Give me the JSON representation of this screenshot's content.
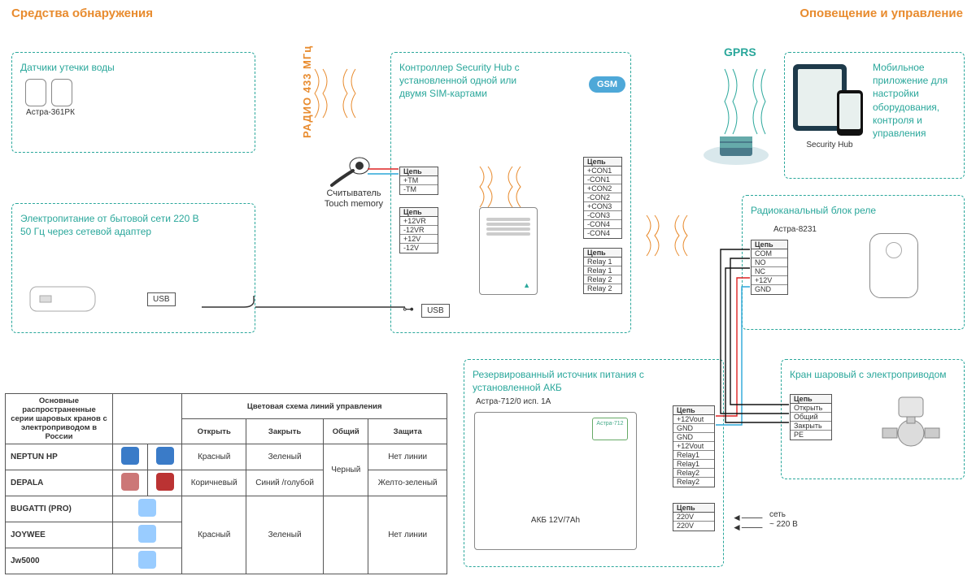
{
  "headings": {
    "left": "Средства обнаружения",
    "right": "Оповещение и управление"
  },
  "links": {
    "radio": "РАДИО 433 МГц",
    "gprs": "GPRS",
    "gsm": "GSM",
    "touch_memory": "Считыватель\nTouch memory"
  },
  "boxes": {
    "water": {
      "title": "Датчики утечки воды",
      "model": "Астра-361РК"
    },
    "power_usb": {
      "title": "Электропитание от бытовой сети 220 В 50 Гц через сетевой адаптер",
      "usb": "USB"
    },
    "controller": {
      "title": "Контроллер Security Hub с установленной одной или двумя SIM-картами",
      "usb": "USB"
    },
    "mobile": {
      "title": "Мобильное приложение для настройки оборудования, контроля и управления",
      "sub": "Security Hub"
    },
    "relay_radio": {
      "title": "Радиоканальный блок реле",
      "model": "Астра-8231"
    },
    "psu": {
      "title": "Резервированный источник питания с установленной АКБ",
      "model": "Астра-712/0 исп. 1А",
      "akb": "АКБ 12V/7Ah"
    },
    "valve": {
      "title": "Кран шаровый с электроприводом"
    },
    "mains": {
      "label1": "сеть",
      "label2": "~ 220 В"
    }
  },
  "terminals": {
    "head": "Цепь",
    "tm": [
      "+ТМ",
      "-ТМ"
    ],
    "pwr12": [
      "+12VR",
      "-12VR",
      "+12V",
      "-12V"
    ],
    "con": [
      "+CON1",
      "-CON1",
      "+CON2",
      "-CON2",
      "+CON3",
      "-CON3",
      "-CON4",
      "-CON4"
    ],
    "relay_hub": [
      "Relay 1",
      "Relay 1",
      "Relay 2",
      "Relay 2"
    ],
    "relay_astra": [
      "COM",
      "NO",
      "NC",
      "+12V",
      "GND"
    ],
    "psu_out": [
      "+12Vout",
      "GND",
      "GND",
      "+12Vout",
      "Relay1",
      "Relay1",
      "Relay2",
      "Relay2"
    ],
    "psu_220": [
      "220V",
      "220V"
    ],
    "valve_t": [
      "Открыть",
      "Общий",
      "Закрыть",
      "PE"
    ]
  },
  "valve_table": {
    "head_left": "Основные распространенные серии шаровых кранов с электроприводом в России",
    "head_right": "Цветовая схема линий управления",
    "cols": [
      "Открыть",
      "Закрыть",
      "Общий",
      "Защита"
    ],
    "rows": [
      {
        "name": "NEPTUN HP",
        "open": "Красный",
        "close": "Зеленый",
        "common": "",
        "prot": "Нет линии"
      },
      {
        "name": "DEPALA",
        "open": "Коричневый",
        "close": "Синий /голубой",
        "common": "Черный",
        "prot": "Желто-зеленый"
      },
      {
        "name": "BUGATTI (PRO)",
        "open": "",
        "close": "",
        "common": "",
        "prot": ""
      },
      {
        "name": "JOYWEE",
        "open": "Красный",
        "close": "Зеленый",
        "common": "",
        "prot": "Нет линии"
      },
      {
        "name": "Jw5000",
        "open": "",
        "close": "",
        "common": "",
        "prot": ""
      }
    ]
  }
}
